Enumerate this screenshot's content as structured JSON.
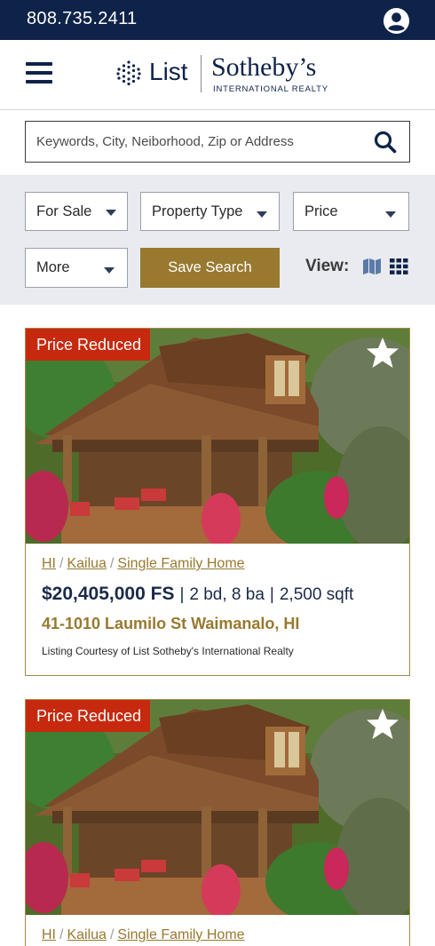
{
  "topbar": {
    "phone": "808.735.2411",
    "account_icon": "account-circle-icon"
  },
  "header": {
    "menu_icon": "hamburger-menu-icon",
    "logo_list": "List",
    "logo_brand": "Sotheby’s",
    "logo_tagline": "INTERNATIONAL REALTY"
  },
  "search": {
    "placeholder": "Keywords, City, Neiborhood, Zip or Address",
    "value": "",
    "icon": "search-icon"
  },
  "filters": {
    "status": "For Sale",
    "property_type": "Property Type",
    "price": "Price",
    "more": "More",
    "save_search": "Save Search",
    "view_label": "View:"
  },
  "colors": {
    "navy": "#0e2349",
    "gold": "#98792f",
    "badge_red": "#c7290e",
    "filter_bg": "#e9ebf0"
  },
  "listings": [
    {
      "badge": "Price Reduced",
      "crumbs": [
        "HI",
        "Kailua",
        "Single Family Home"
      ],
      "price": "$20,405,000 FS",
      "beds": "2  bd, 8 ba",
      "sqft": "2,500 sqft",
      "address": "41-1010 Laumilo St Waimanalo, HI",
      "courtesy": "Listing Courtesy of List Sotheby's International Realty"
    },
    {
      "badge": "Price Reduced",
      "crumbs": [
        "HI",
        "Kailua",
        "Single Family Home"
      ]
    }
  ]
}
